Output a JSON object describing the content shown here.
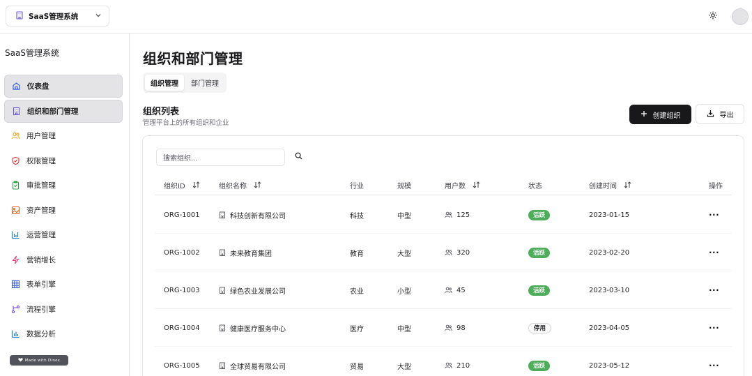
{
  "topbar": {
    "app_name": "SaaS管理系统",
    "icons": {
      "app": "building-icon",
      "chevron": "chevron-down-icon",
      "theme": "sun-icon",
      "avatar": "avatar"
    }
  },
  "sidebar": {
    "title": "SaaS管理系统",
    "items": [
      {
        "label": "仪表盘",
        "icon": "home-icon",
        "active": false,
        "highlight": true
      },
      {
        "label": "组织和部门管理",
        "icon": "building-icon",
        "active": true
      },
      {
        "label": "用户管理",
        "icon": "users-icon"
      },
      {
        "label": "权限管理",
        "icon": "shield-icon"
      },
      {
        "label": "审批管理",
        "icon": "clipboard-check-icon"
      },
      {
        "label": "资产管理",
        "icon": "image-icon"
      },
      {
        "label": "运营管理",
        "icon": "bar-chart-icon"
      },
      {
        "label": "营销增长",
        "icon": "zap-icon"
      },
      {
        "label": "表单引擎",
        "icon": "table-icon"
      },
      {
        "label": "流程引擎",
        "icon": "workflow-icon"
      },
      {
        "label": "数据分析",
        "icon": "chart-icon"
      }
    ],
    "made_with": "Made with Dinox"
  },
  "main": {
    "title": "组织和部门管理",
    "tabs": [
      {
        "label": "组织管理",
        "active": true
      },
      {
        "label": "部门管理",
        "active": false
      }
    ],
    "section_title": "组织列表",
    "section_desc": "管理平台上的所有组织和企业",
    "create_label": "创建组织",
    "export_label": "导出",
    "search_placeholder": "搜索组织...",
    "columns": [
      "组织ID",
      "组织名称",
      "行业",
      "规模",
      "用户数",
      "状态",
      "创建时间",
      "操作"
    ],
    "rows": [
      {
        "id": "ORG-1001",
        "name": "科技创新有限公司",
        "industry": "科技",
        "scale": "中型",
        "users": "125",
        "status": "活跃",
        "status_type": "active",
        "created": "2023-01-15",
        "action": "···"
      },
      {
        "id": "ORG-1002",
        "name": "未来教育集团",
        "industry": "教育",
        "scale": "大型",
        "users": "320",
        "status": "活跃",
        "status_type": "active",
        "created": "2023-02-20",
        "action": "···"
      },
      {
        "id": "ORG-1003",
        "name": "绿色农业发展公司",
        "industry": "农业",
        "scale": "小型",
        "users": "45",
        "status": "活跃",
        "status_type": "active",
        "created": "2023-03-10",
        "action": "···"
      },
      {
        "id": "ORG-1004",
        "name": "健康医疗服务中心",
        "industry": "医疗",
        "scale": "中型",
        "users": "98",
        "status": "停用",
        "status_type": "inactive",
        "created": "2023-04-05",
        "action": "···"
      },
      {
        "id": "ORG-1005",
        "name": "全球贸易有限公司",
        "industry": "贸易",
        "scale": "大型",
        "users": "210",
        "status": "活跃",
        "status_type": "active",
        "created": "2023-05-12",
        "action": "···"
      }
    ]
  },
  "colors": {
    "primary": "#18181b",
    "active_badge": "#4ead5b",
    "border": "#e4e4e7",
    "icon_accent": "#6d5bd0"
  }
}
